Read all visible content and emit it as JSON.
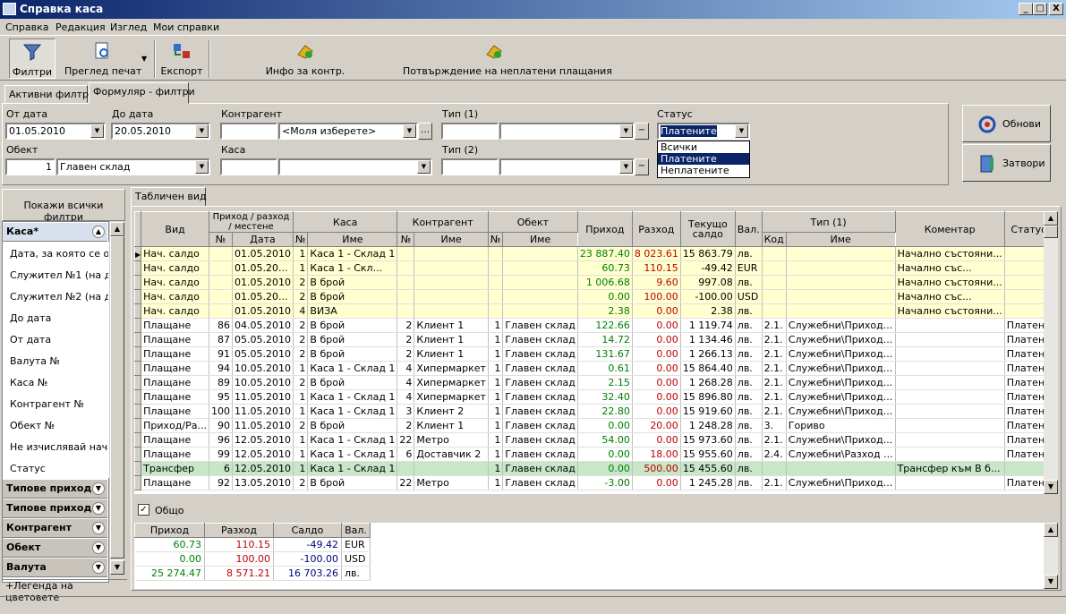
{
  "window": {
    "title": "Справка каса",
    "controls": [
      "_",
      "□",
      "X"
    ]
  },
  "menu": [
    "Справка",
    "Редакция",
    "Изглед",
    "Мои справки"
  ],
  "toolbar": {
    "filters": "Филтри",
    "preview": "Преглед печат",
    "export": "Експорт",
    "info": "Инфо за контр.",
    "confirm": "Потвърждение на неплатени плащания"
  },
  "tabs": {
    "active_filters": "Активни филтри",
    "form_filters": "Формуляр - филтри"
  },
  "form": {
    "from_date_label": "От дата",
    "from_date": "01.05.2010",
    "to_date_label": "До дата",
    "to_date": "20.05.2010",
    "contractor_label": "Контрагент",
    "contractor_code": "",
    "contractor_value": "<Моля изберете>",
    "type1_label": "Тип (1)",
    "type2_label": "Тип (2)",
    "status_label": "Статус",
    "status_value": "Платените",
    "object_label": "Обект",
    "object_code": "1",
    "object_value": "Главен склад",
    "cash_label": "Каса"
  },
  "status_options": [
    "Всички",
    "Платените",
    "Неплатените"
  ],
  "buttons": {
    "refresh": "Обнови",
    "close": "Затвори"
  },
  "left": {
    "show_all": "Покажи всички филтри",
    "groups": [
      "Каса*",
      "Типове приход...",
      "Типове приход...",
      "Контрагент",
      "Обект",
      "Валута"
    ],
    "items": [
      "Дата, за която се отн",
      "Служител №1 (на док.",
      "Служител №2 (на док.",
      "До дата",
      "От дата",
      "Валута №",
      "Каса №",
      "Контрагент №",
      "Обект №",
      "Не изчислявай начал",
      "Статус"
    ]
  },
  "view_tab": "Табличен вид",
  "grid": {
    "headers": {
      "vid": "Вид",
      "doc": "Приход / разход / местене",
      "kasa": "Каса",
      "kontr": "Контрагент",
      "obekt": "Обект",
      "prihod": "Приход",
      "razhod": "Разход",
      "saldo": "Текущо салдо",
      "val": "Вал.",
      "tip": "Тип (1)",
      "koment": "Коментар",
      "status": "Статус"
    },
    "sub": {
      "no": "№",
      "date": "Дата",
      "name": "Име",
      "code": "Код"
    },
    "rows": [
      {
        "cls": "yel",
        "vid": "Нач. салдо",
        "dno": "",
        "date": "01.05.2010",
        "kn": "1",
        "kname": "Каса 1 - Склад 1",
        "cn": "",
        "cname": "",
        "on": "",
        "oname": "",
        "in": "23 887.40",
        "out": "8 023.61",
        "bal": "15 863.79",
        "cur": "лв.",
        "tc": "",
        "tn": "",
        "com": "Начално състояни...",
        "st": ""
      },
      {
        "cls": "yel b",
        "vid": "Нач. салдо",
        "dno": "",
        "date": "01.05.20...",
        "kn": "1",
        "kname": "Каса 1 - Скл...",
        "cn": "",
        "cname": "",
        "on": "",
        "oname": "",
        "in": "60.73",
        "out": "110.15",
        "bal": "-49.42",
        "cur": "EUR",
        "tc": "",
        "tn": "",
        "com": "Начално със...",
        "st": ""
      },
      {
        "cls": "yel",
        "vid": "Нач. салдо",
        "dno": "",
        "date": "01.05.2010",
        "kn": "2",
        "kname": "В брой",
        "cn": "",
        "cname": "",
        "on": "",
        "oname": "",
        "in": "1 006.68",
        "out": "9.60",
        "bal": "997.08",
        "cur": "лв.",
        "tc": "",
        "tn": "",
        "com": "Начално състояни...",
        "st": ""
      },
      {
        "cls": "yel b",
        "vid": "Нач. салдо",
        "dno": "",
        "date": "01.05.20...",
        "kn": "2",
        "kname": "В брой",
        "cn": "",
        "cname": "",
        "on": "",
        "oname": "",
        "in": "0.00",
        "out": "100.00",
        "bal": "-100.00",
        "cur": "USD",
        "tc": "",
        "tn": "",
        "com": "Начално със...",
        "st": ""
      },
      {
        "cls": "yel",
        "vid": "Нач. салдо",
        "dno": "",
        "date": "01.05.2010",
        "kn": "4",
        "kname": "ВИЗА",
        "cn": "",
        "cname": "",
        "on": "",
        "oname": "",
        "in": "2.38",
        "out": "0.00",
        "bal": "2.38",
        "cur": "лв.",
        "tc": "",
        "tn": "",
        "com": "Начално състояни...",
        "st": ""
      },
      {
        "cls": "",
        "vid": "Плащане",
        "dno": "86",
        "date": "04.05.2010",
        "kn": "2",
        "kname": "В брой",
        "cn": "2",
        "cname": "Клиент 1",
        "on": "1",
        "oname": "Главен склад",
        "in": "122.66",
        "out": "0.00",
        "bal": "1 119.74",
        "cur": "лв.",
        "tc": "2.1.",
        "tn": "Служебни\\Приход...",
        "com": "",
        "st": "Платено"
      },
      {
        "cls": "",
        "vid": "Плащане",
        "dno": "87",
        "date": "05.05.2010",
        "kn": "2",
        "kname": "В брой",
        "cn": "2",
        "cname": "Клиент 1",
        "on": "1",
        "oname": "Главен склад",
        "in": "14.72",
        "out": "0.00",
        "bal": "1 134.46",
        "cur": "лв.",
        "tc": "2.1.",
        "tn": "Служебни\\Приход...",
        "com": "",
        "st": "Платено"
      },
      {
        "cls": "",
        "vid": "Плащане",
        "dno": "91",
        "date": "05.05.2010",
        "kn": "2",
        "kname": "В брой",
        "cn": "2",
        "cname": "Клиент 1",
        "on": "1",
        "oname": "Главен склад",
        "in": "131.67",
        "out": "0.00",
        "bal": "1 266.13",
        "cur": "лв.",
        "tc": "2.1.",
        "tn": "Служебни\\Приход...",
        "com": "",
        "st": "Платено"
      },
      {
        "cls": "",
        "vid": "Плащане",
        "dno": "94",
        "date": "10.05.2010",
        "kn": "1",
        "kname": "Каса 1 - Склад 1",
        "cn": "4",
        "cname": "Хипермаркет",
        "on": "1",
        "oname": "Главен склад",
        "in": "0.61",
        "out": "0.00",
        "bal": "15 864.40",
        "cur": "лв.",
        "tc": "2.1.",
        "tn": "Служебни\\Приход...",
        "com": "",
        "st": "Платено"
      },
      {
        "cls": "",
        "vid": "Плащане",
        "dno": "89",
        "date": "10.05.2010",
        "kn": "2",
        "kname": "В брой",
        "cn": "4",
        "cname": "Хипермаркет",
        "on": "1",
        "oname": "Главен склад",
        "in": "2.15",
        "out": "0.00",
        "bal": "1 268.28",
        "cur": "лв.",
        "tc": "2.1.",
        "tn": "Служебни\\Приход...",
        "com": "",
        "st": "Платено"
      },
      {
        "cls": "",
        "vid": "Плащане",
        "dno": "95",
        "date": "11.05.2010",
        "kn": "1",
        "kname": "Каса 1 - Склад 1",
        "cn": "4",
        "cname": "Хипермаркет",
        "on": "1",
        "oname": "Главен склад",
        "in": "32.40",
        "out": "0.00",
        "bal": "15 896.80",
        "cur": "лв.",
        "tc": "2.1.",
        "tn": "Служебни\\Приход...",
        "com": "",
        "st": "Платено"
      },
      {
        "cls": "",
        "vid": "Плащане",
        "dno": "100",
        "date": "11.05.2010",
        "kn": "1",
        "kname": "Каса 1 - Склад 1",
        "cn": "3",
        "cname": "Клиент 2",
        "on": "1",
        "oname": "Главен склад",
        "in": "22.80",
        "out": "0.00",
        "bal": "15 919.60",
        "cur": "лв.",
        "tc": "2.1.",
        "tn": "Служебни\\Приход...",
        "com": "",
        "st": "Платено"
      },
      {
        "cls": "",
        "vid": "Приход/Ра...",
        "dno": "90",
        "date": "11.05.2010",
        "kn": "2",
        "kname": "В брой",
        "cn": "2",
        "cname": "Клиент 1",
        "on": "1",
        "oname": "Главен склад",
        "in": "0.00",
        "out": "20.00",
        "bal": "1 248.28",
        "cur": "лв.",
        "tc": "3.",
        "tn": "Гориво",
        "com": "",
        "st": "Платено"
      },
      {
        "cls": "",
        "vid": "Плащане",
        "dno": "96",
        "date": "12.05.2010",
        "kn": "1",
        "kname": "Каса 1 - Склад 1",
        "cn": "22",
        "cname": "Метро",
        "on": "1",
        "oname": "Главен склад",
        "in": "54.00",
        "out": "0.00",
        "bal": "15 973.60",
        "cur": "лв.",
        "tc": "2.1.",
        "tn": "Служебни\\Приход...",
        "com": "",
        "st": "Платено"
      },
      {
        "cls": "",
        "vid": "Плащане",
        "dno": "99",
        "date": "12.05.2010",
        "kn": "1",
        "kname": "Каса 1 - Склад 1",
        "cn": "6",
        "cname": "Доставчик 2",
        "on": "1",
        "oname": "Главен склад",
        "in": "0.00",
        "out": "18.00",
        "bal": "15 955.60",
        "cur": "лв.",
        "tc": "2.4.",
        "tn": "Служебни\\Разход ...",
        "com": "",
        "st": "Платено"
      },
      {
        "cls": "trf",
        "vid": "Трансфер",
        "dno": "6",
        "date": "12.05.2010",
        "kn": "1",
        "kname": "Каса 1 - Склад 1",
        "cn": "",
        "cname": "",
        "on": "1",
        "oname": "Главен склад",
        "in": "0.00",
        "out": "500.00",
        "bal": "15 455.60",
        "cur": "лв.",
        "tc": "",
        "tn": "",
        "com": "Трансфер към В б...",
        "st": ""
      },
      {
        "cls": "",
        "vid": "Плащане",
        "dno": "92",
        "date": "13.05.2010",
        "kn": "2",
        "kname": "В брой",
        "cn": "22",
        "cname": "Метро",
        "on": "1",
        "oname": "Главен склад",
        "in": "-3.00",
        "out": "0.00",
        "bal": "1 245.28",
        "cur": "лв.",
        "tc": "2.1.",
        "tn": "Служебни\\Приход...",
        "com": "",
        "st": "Платено"
      }
    ]
  },
  "totals": {
    "check_label": "Общо",
    "headers": [
      "Приход",
      "Разход",
      "Салдо",
      "Вал."
    ],
    "rows": [
      [
        "60.73",
        "110.15",
        "-49.42",
        "EUR"
      ],
      [
        "0.00",
        "100.00",
        "-100.00",
        "USD"
      ],
      [
        "25 274.47",
        "8 571.21",
        "16 703.26",
        "лв."
      ]
    ]
  },
  "legend": "Легенда на цветовете"
}
